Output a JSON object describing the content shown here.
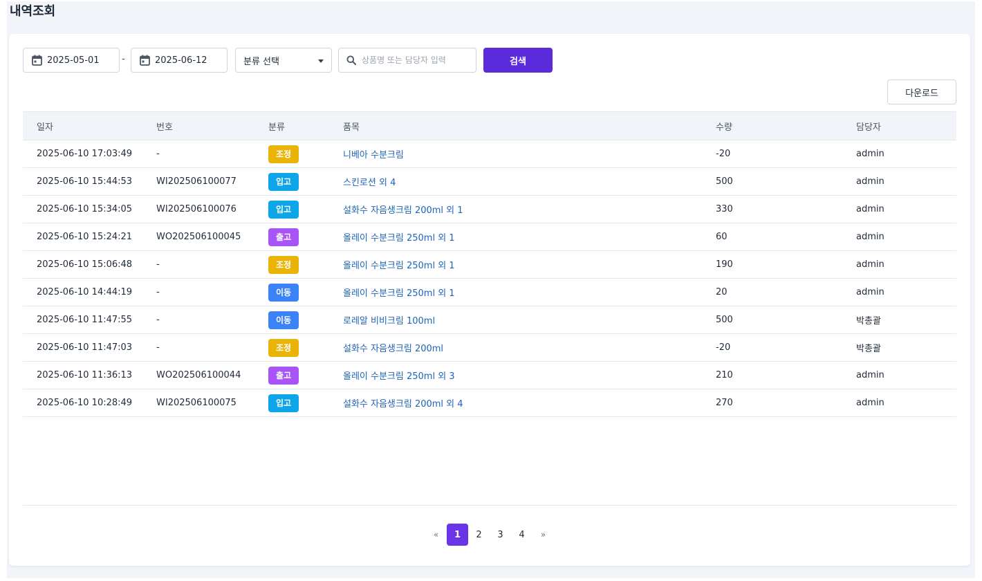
{
  "page": {
    "title": "내역조회"
  },
  "filters": {
    "start_date": "2025-05-01",
    "separator": "-",
    "end_date": "2025-06-12",
    "category_select": "분류 선택",
    "search_placeholder": "상품명 또는 담당자 입력",
    "search_button": "검색"
  },
  "toolbar": {
    "download_label": "다운로드"
  },
  "table": {
    "headers": {
      "date": "일자",
      "number": "번호",
      "category": "분류",
      "item": "품목",
      "quantity": "수량",
      "manager": "담당자"
    },
    "rows": [
      {
        "date": "2025-06-10 17:03:49",
        "number": "-",
        "category": "조정",
        "item": "니베아 수분크림",
        "quantity": "-20",
        "manager": "admin"
      },
      {
        "date": "2025-06-10 15:44:53",
        "number": "WI202506100077",
        "category": "입고",
        "item": "스킨로션 외 4",
        "quantity": "500",
        "manager": "admin"
      },
      {
        "date": "2025-06-10 15:34:05",
        "number": "WI202506100076",
        "category": "입고",
        "item": "설화수 자음생크림 200ml 외 1",
        "quantity": "330",
        "manager": "admin"
      },
      {
        "date": "2025-06-10 15:24:21",
        "number": "WO202506100045",
        "category": "출고",
        "item": "올레이 수분크림 250ml 외 1",
        "quantity": "60",
        "manager": "admin"
      },
      {
        "date": "2025-06-10 15:06:48",
        "number": "-",
        "category": "조정",
        "item": "올레이 수분크림 250ml 외 1",
        "quantity": "190",
        "manager": "admin"
      },
      {
        "date": "2025-06-10 14:44:19",
        "number": "-",
        "category": "이동",
        "item": "올레이 수분크림 250ml 외 1",
        "quantity": "20",
        "manager": "admin"
      },
      {
        "date": "2025-06-10 11:47:55",
        "number": "-",
        "category": "이동",
        "item": "로레알 비비크림 100ml",
        "quantity": "500",
        "manager": "박총괄"
      },
      {
        "date": "2025-06-10 11:47:03",
        "number": "-",
        "category": "조정",
        "item": "설화수 자음생크림 200ml",
        "quantity": "-20",
        "manager": "박총괄"
      },
      {
        "date": "2025-06-10 11:36:13",
        "number": "WO202506100044",
        "category": "출고",
        "item": "올레이 수분크림 250ml 외 3",
        "quantity": "210",
        "manager": "admin"
      },
      {
        "date": "2025-06-10 10:28:49",
        "number": "WI202506100075",
        "category": "입고",
        "item": "설화수 자음생크림 200ml 외 4",
        "quantity": "270",
        "manager": "admin"
      }
    ]
  },
  "category_colors": {
    "조정": "#eab308",
    "입고": "#0ea5e9",
    "출고": "#a855f7",
    "이동": "#3b82f6"
  },
  "pagination": {
    "prev": "«",
    "pages": [
      "1",
      "2",
      "3",
      "4"
    ],
    "current": "1",
    "next": "»"
  },
  "icons": {
    "date": "calendar-icon",
    "select": "chevron-down-icon",
    "search": "search-icon"
  }
}
